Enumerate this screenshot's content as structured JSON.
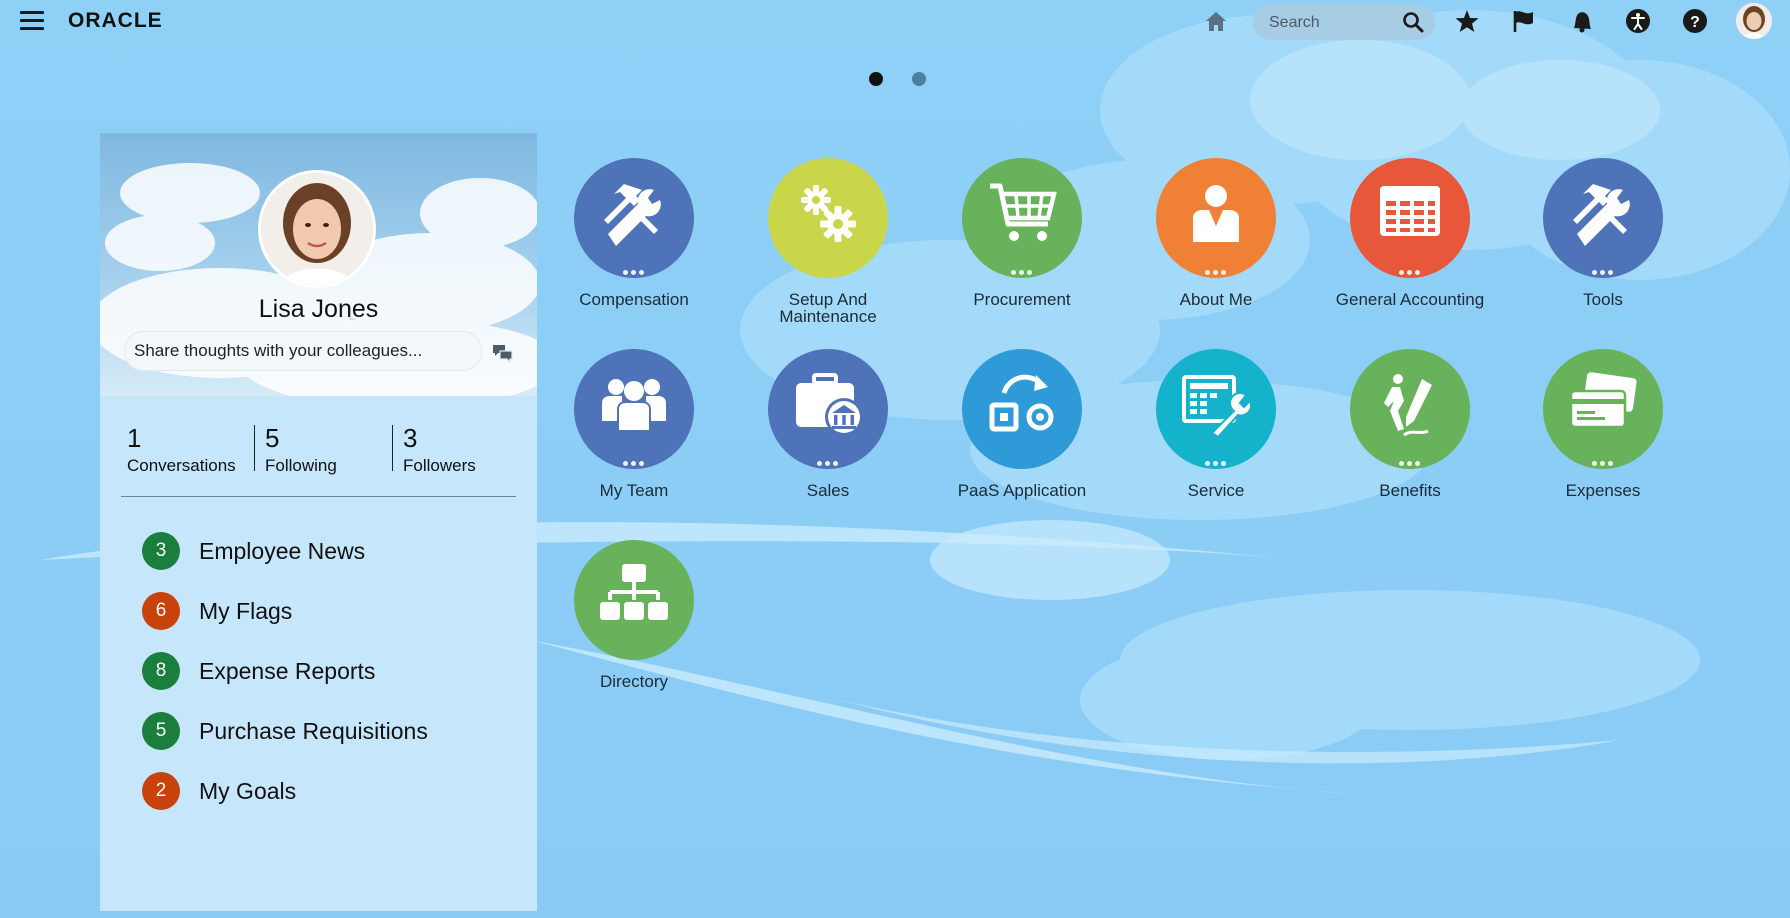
{
  "header": {
    "logo_text": "ORACLE",
    "search": {
      "placeholder": "Search"
    },
    "icons": [
      "menu-icon",
      "home-icon",
      "search-icon",
      "star-icon",
      "flag-icon",
      "bell-icon",
      "accessibility-icon",
      "help-icon",
      "avatar"
    ]
  },
  "pager": {
    "pages": 2,
    "current": 1
  },
  "profile": {
    "name": "Lisa Jones",
    "share_placeholder": "Share thoughts with your colleagues...",
    "stats": [
      {
        "value": "1",
        "label": "Conversations"
      },
      {
        "value": "5",
        "label": "Following"
      },
      {
        "value": "3",
        "label": "Followers"
      }
    ],
    "tasks": [
      {
        "count": "3",
        "label": "Employee News",
        "color": "#1a7f3c"
      },
      {
        "count": "6",
        "label": "My Flags",
        "color": "#c8420c"
      },
      {
        "count": "8",
        "label": "Expense Reports",
        "color": "#1a7f3c"
      },
      {
        "count": "5",
        "label": "Purchase Requisitions",
        "color": "#1a7f3c"
      },
      {
        "count": "2",
        "label": "My Goals",
        "color": "#c8420c"
      }
    ]
  },
  "apps": [
    {
      "label": "Compensation",
      "icon": "hammer-wrench-icon",
      "color": "#4f73b8"
    },
    {
      "label": "Setup And\nMaintenance",
      "icon": "gears-icon",
      "color": "#c9d64a"
    },
    {
      "label": "Procurement",
      "icon": "cart-icon",
      "color": "#67b25a"
    },
    {
      "label": "About Me",
      "icon": "person-icon",
      "color": "#ef8036"
    },
    {
      "label": "General Accounting",
      "icon": "ledger-icon",
      "color": "#e8573a"
    },
    {
      "label": "Tools",
      "icon": "hammer-wrench-icon",
      "color": "#4f73b8"
    },
    {
      "label": "My Team",
      "icon": "team-icon",
      "color": "#4f73b8"
    },
    {
      "label": "Sales",
      "icon": "briefcase-bank-icon",
      "color": "#4f73b8"
    },
    {
      "label": "PaaS Application",
      "icon": "paas-icon",
      "color": "#2f9ad8"
    },
    {
      "label": "Service",
      "icon": "service-icon",
      "color": "#14b3cb"
    },
    {
      "label": "Benefits",
      "icon": "benefits-icon",
      "color": "#67b25a"
    },
    {
      "label": "Expenses",
      "icon": "cards-icon",
      "color": "#67b25a"
    },
    {
      "label": "Directory",
      "icon": "org-chart-icon",
      "color": "#67b25a"
    }
  ],
  "colors": {
    "sky": "#8ccdf6",
    "panel": "#c6e6fb",
    "dot_active": "#111111",
    "dot_inactive": "#4f7f9c"
  }
}
